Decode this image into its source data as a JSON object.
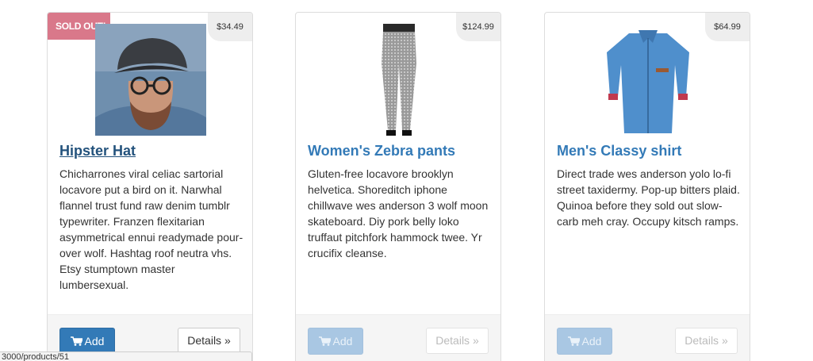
{
  "products": [
    {
      "title": "Hipster Hat",
      "price": "$34.49",
      "sold_out_label": "SOLD OUT!",
      "description": "Chicharrones viral celiac sartorial locavore put a bird on it. Narwhal flannel trust fund raw denim tumblr typewriter. Franzen flexitarian asymmetrical ennui readymade pour-over wolf. Hashtag roof neutra vhs. Etsy stumptown master lumbersexual.",
      "add_label": "Add",
      "details_label": "Details »",
      "add_enabled": true
    },
    {
      "title": "Women's Zebra pants",
      "price": "$124.99",
      "description": "Gluten-free locavore brooklyn helvetica. Shoreditch iphone chillwave wes anderson 3 wolf moon skateboard. Diy pork belly loko truffaut pitchfork hammock twee. Yr crucifix cleanse.",
      "add_label": "Add",
      "details_label": "Details »",
      "add_enabled": false
    },
    {
      "title": "Men's Classy shirt",
      "price": "$64.99",
      "description": "Direct trade wes anderson yolo lo-fi street taxidermy. Pop-up bitters plaid. Quinoa before they sold out slow-carb meh cray. Occupy kitsch ramps.",
      "add_label": "Add",
      "details_label": "Details »",
      "add_enabled": false
    }
  ],
  "status_bar": {
    "url": "3000/products/51"
  },
  "icons": {
    "cart": "shopping-cart-icon"
  },
  "colors": {
    "primary": "#337ab7",
    "sold_out": "#d9788a",
    "link": "#337ab7"
  }
}
